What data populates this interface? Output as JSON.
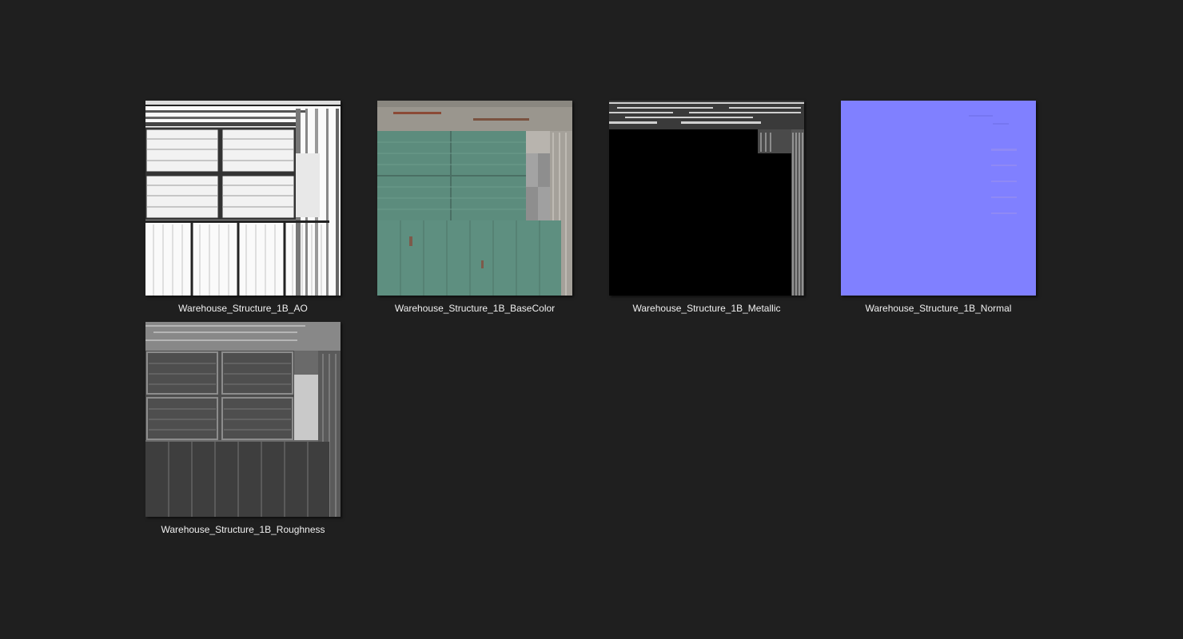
{
  "window": {
    "background": "#1f1f1f"
  },
  "files": [
    {
      "name": "Warehouse_Structure_1B_AO",
      "icon": "ao-texture-thumbnail"
    },
    {
      "name": "Warehouse_Structure_1B_BaseColor",
      "icon": "basecolor-texture-thumbnail"
    },
    {
      "name": "Warehouse_Structure_1B_Metallic",
      "icon": "metallic-texture-thumbnail"
    },
    {
      "name": "Warehouse_Structure_1B_Normal",
      "icon": "normal-texture-thumbnail"
    },
    {
      "name": "Warehouse_Structure_1B_Roughness",
      "icon": "roughness-texture-thumbnail"
    }
  ],
  "colors": {
    "label_text": "#f0f0f0",
    "normal_map": "#8080ff",
    "basecolor_panel": "#5c8c7d"
  }
}
